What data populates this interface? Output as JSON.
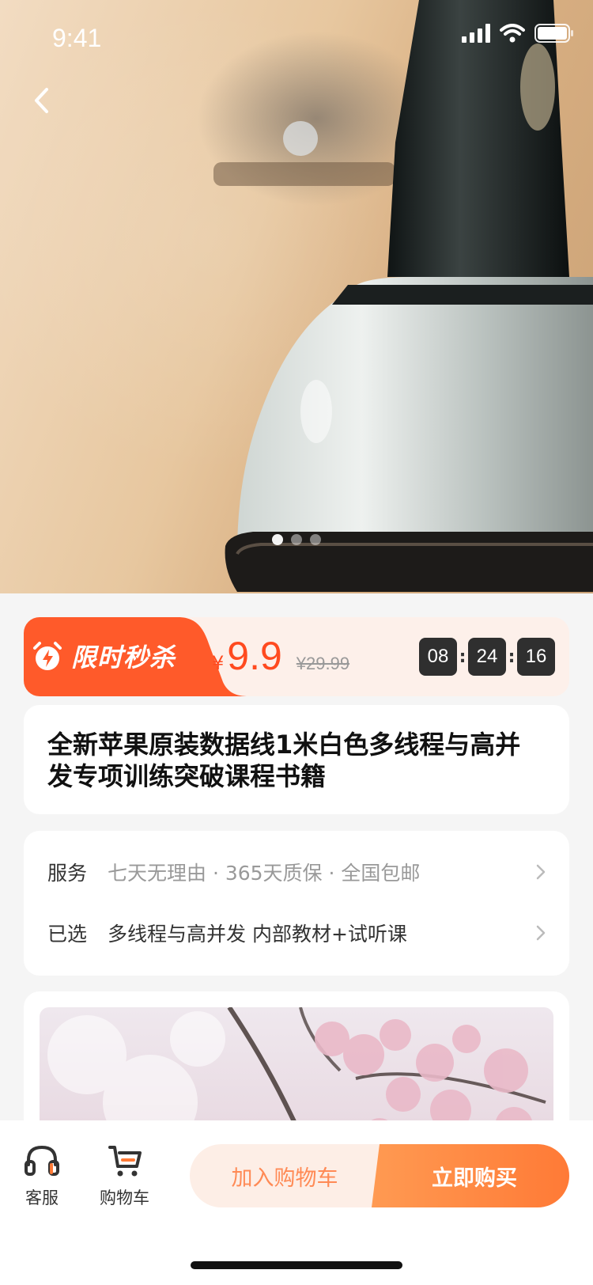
{
  "status_bar": {
    "time": "9:41"
  },
  "gallery": {
    "active_index": 0,
    "count": 3
  },
  "flash_sale": {
    "title": "限时秒杀",
    "currency": "¥",
    "price": "9.9",
    "original_price": "¥29.99",
    "countdown": [
      "08",
      "24",
      "16"
    ]
  },
  "product": {
    "title": "全新苹果原装数据线1米白色多线程与高并发专项训练突破课程书籍"
  },
  "services": {
    "service_label": "服务",
    "service_value": "七天无理由 · 365天质保 · 全国包邮",
    "selected_label": "已选",
    "selected_value": "多线程与高并发 内部教材+试听课"
  },
  "bottom_bar": {
    "service_label": "客服",
    "cart_label": "购物车",
    "add_to_cart": "加入购物车",
    "buy_now": "立即购买"
  },
  "colors": {
    "accent": "#ff5a2a",
    "buy_gradient_start": "#ff9a52",
    "buy_gradient_end": "#ff7a36"
  }
}
